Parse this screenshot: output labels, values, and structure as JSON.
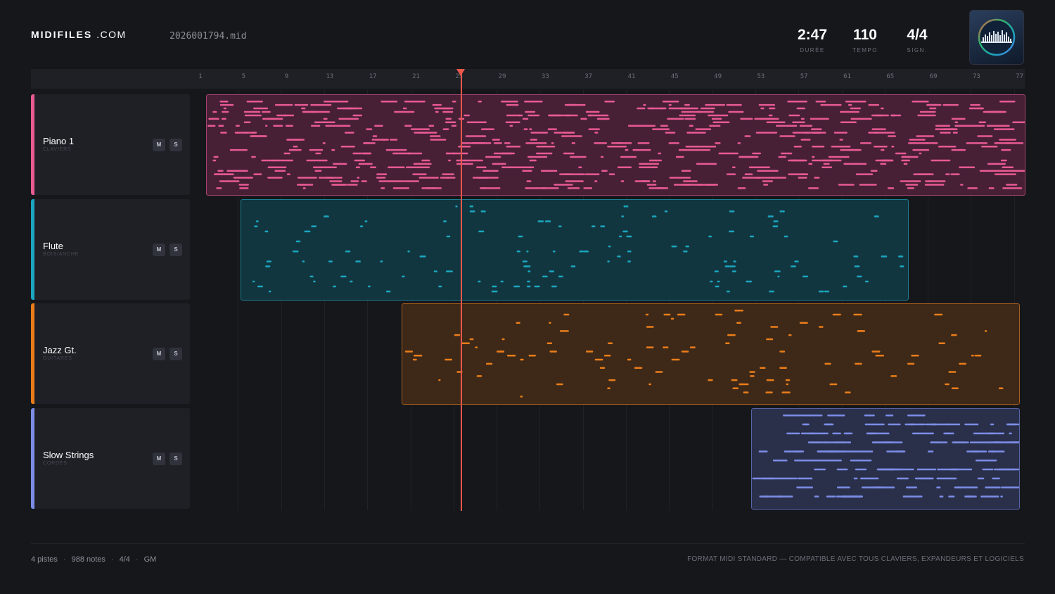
{
  "header": {
    "logo_main": "MIDIFILES",
    "logo_suffix": ".COM",
    "filename": "2026001794.mid",
    "stats": [
      {
        "value": "2:47",
        "label": "DURÉE"
      },
      {
        "value": "110",
        "label": "TEMPO"
      },
      {
        "value": "4/4",
        "label": "SIGN."
      }
    ],
    "thumbnail_icon": "waveform-disc-icon"
  },
  "ruler": {
    "ticks": [
      "1",
      "5",
      "9",
      "13",
      "17",
      "21",
      "25",
      "29",
      "33",
      "37",
      "41",
      "45",
      "49",
      "53",
      "57",
      "61",
      "65",
      "69",
      "73",
      "77"
    ],
    "playhead_bar": 25
  },
  "tracks": [
    {
      "name": "Piano 1",
      "category": "CLAVIERS",
      "color": "#e85a92",
      "fill": "#472036",
      "mute": "M",
      "solo": "S"
    },
    {
      "name": "Flute",
      "category": "BOIS/ANCHE",
      "color": "#1ba6c0",
      "fill": "#12363f",
      "mute": "M",
      "solo": "S"
    },
    {
      "name": "Jazz Gt.",
      "category": "GUITARES",
      "color": "#ea7d1a",
      "fill": "#3e2918",
      "mute": "M",
      "solo": "S"
    },
    {
      "name": "Slow Strings",
      "category": "CORDES",
      "color": "#7b8de6",
      "fill": "#2a2f4a",
      "mute": "M",
      "solo": "S"
    }
  ],
  "footer": {
    "tracks": "4 pistes",
    "notes": "988 notes",
    "signature": "4/4",
    "standard": "GM",
    "note": "FORMAT MIDI STANDARD — COMPATIBLE AVEC TOUS CLAVIERS, EXPANDEURS ET LOGICIELS"
  }
}
